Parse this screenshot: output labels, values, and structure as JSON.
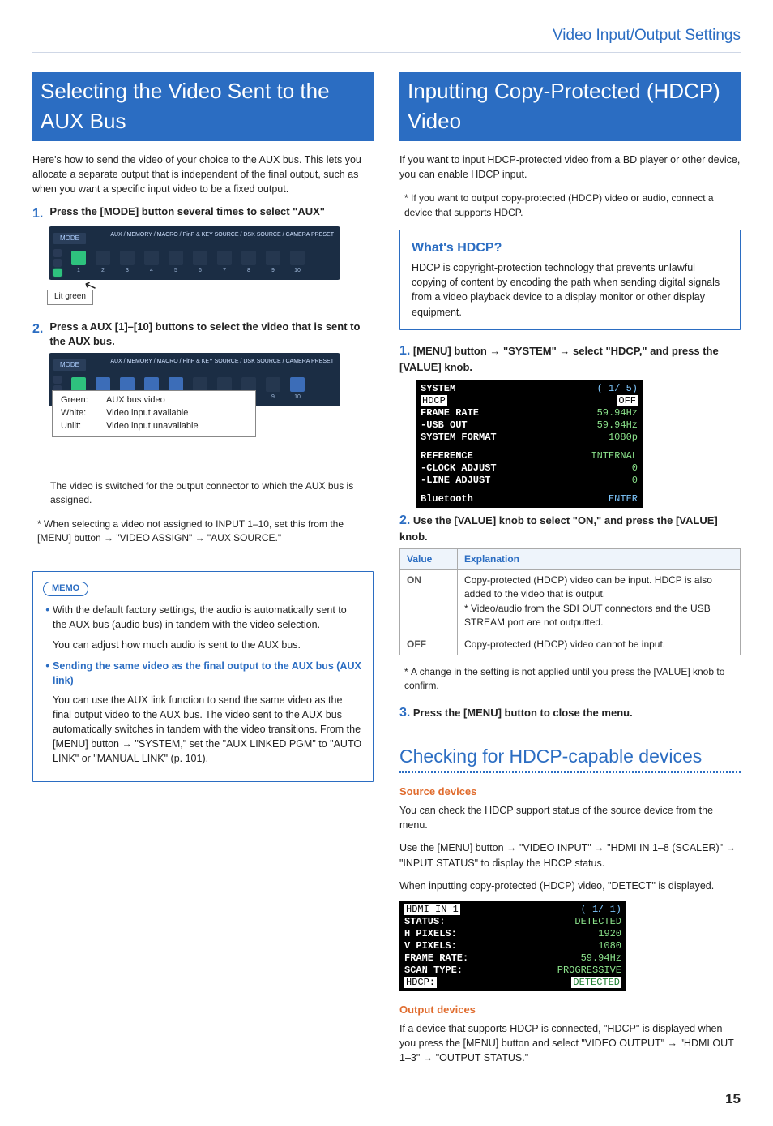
{
  "header": "Video Input/Output Settings",
  "pageNumber": "15",
  "left": {
    "title": "Selecting the Video Sent to the AUX Bus",
    "intro": "Here's how to send the video of your choice to the AUX bus. This lets you allocate a separate output that is independent of the final output, such as when you want a specific input video to be a fixed output.",
    "step1_text": "Press the [MODE] button several times to select \"AUX\"",
    "strip_mode": "MODE",
    "strip_right": "AUX / MEMORY / MACRO / PinP & KEY SOURCE / DSK SOURCE / CAMERA PRESET",
    "callout_lit": "Lit green",
    "step2_text": "Press a AUX [1]–[10] buttons to select the video that is sent to the AUX bus.",
    "legend": {
      "g_k": "Green:",
      "g_v": "AUX bus video",
      "w_k": "White:",
      "w_v": "Video input available",
      "u_k": "Unlit:",
      "u_v": "Video input unavailable"
    },
    "step2_sub": "The video is switched for the output connector to which the AUX bus is assigned.",
    "step2_star": "When selecting a video not assigned to INPUT 1–10, set this from the [MENU] button → \"VIDEO ASSIGN\" → \"AUX SOURCE.\"",
    "memo_label": "MEMO",
    "memo_b1": "With the default factory settings, the audio is automatically sent to the AUX bus (audio bus) in tandem with the video selection.",
    "memo_b1b": "You can adjust how much audio is sent to the AUX bus.",
    "memo_b2_link": "Sending the same video as the final output to the AUX bus (AUX link)",
    "memo_b2_body": "You can use the AUX link function to send the same video as the final output video to the AUX bus. The video sent to the AUX bus automatically switches in tandem with the video transitions. From the [MENU] button → \"SYSTEM,\" set the \"AUX LINKED PGM\" to \"AUTO LINK\" or \"MANUAL LINK\" (p. 101)."
  },
  "right": {
    "title": "Inputting Copy-Protected (HDCP) Video",
    "intro": "If you want to input HDCP-protected video from a BD player or other device, you can enable HDCP input.",
    "intro_star": "If you want to output copy-protected (HDCP) video or audio, connect a device that supports HDCP.",
    "info_h": "What's HDCP?",
    "info_body": "HDCP is copyright-protection technology that prevents unlawful copying of content by encoding the path when sending digital signals from a video playback device to a display monitor or other display equipment.",
    "step1_text": "[MENU] button → \"SYSTEM\" → select \"HDCP,\" and press the [VALUE] knob.",
    "menu1": {
      "title": "SYSTEM",
      "page": "( 1/ 5)",
      "row2_l": "HDCP",
      "row2_r": "OFF",
      "row3_l": "FRAME RATE",
      "row3_r": "59.94Hz",
      "row4_l": " -USB OUT",
      "row4_r": "59.94Hz",
      "row5_l": "SYSTEM FORMAT",
      "row5_r": "1080p",
      "row6_l": "REFERENCE",
      "row6_r": "INTERNAL",
      "row7_l": " -CLOCK ADJUST",
      "row7_r": "0",
      "row8_l": " -LINE ADJUST",
      "row8_r": "0",
      "row9_l": "Bluetooth",
      "row9_r": "ENTER"
    },
    "step2_text": "Use the [VALUE] knob to select \"ON,\" and press the [VALUE] knob.",
    "table": {
      "h1": "Value",
      "h2": "Explanation",
      "r1_k": "ON",
      "r1_v1": "Copy-protected (HDCP) video can be input. HDCP is also added to the video that is output.",
      "r1_v2": "* Video/audio from the SDI OUT connectors and the USB STREAM port are not outputted.",
      "r2_k": "OFF",
      "r2_v": "Copy-protected (HDCP) video cannot be input."
    },
    "table_star": "A change in the setting is not applied until you press the [VALUE] knob to confirm.",
    "step3_text": "Press the [MENU] button to close the menu.",
    "sub_h2": "Checking for HDCP-capable devices",
    "src_h": "Source devices",
    "src_p1": "You can check the HDCP support status of the source device from the menu.",
    "src_p2": "Use the [MENU] button → \"VIDEO INPUT\" → \"HDMI IN 1–8 (SCALER)\" → \"INPUT STATUS\" to display the HDCP status.",
    "src_p3": "When inputting copy-protected (HDCP) video, \"DETECT\" is displayed.",
    "menu2": {
      "r1_l": "HDMI IN 1",
      "r1_r": "( 1/ 1)",
      "r2_l": "STATUS:",
      "r2_r": "DETECTED",
      "r3_l": "H PIXELS:",
      "r3_r": "1920",
      "r4_l": "V PIXELS:",
      "r4_r": "1080",
      "r5_l": "FRAME RATE:",
      "r5_r": "59.94Hz",
      "r6_l": "SCAN TYPE:",
      "r6_r": "PROGRESSIVE",
      "r7_l": "HDCP:",
      "r7_r": "DETECTED"
    },
    "out_h": "Output devices",
    "out_p": "If a device that supports HDCP is connected, \"HDCP\" is displayed when you press the [MENU] button and select \"VIDEO OUTPUT\" → \"HDMI OUT 1–3\" → \"OUTPUT STATUS.\""
  }
}
